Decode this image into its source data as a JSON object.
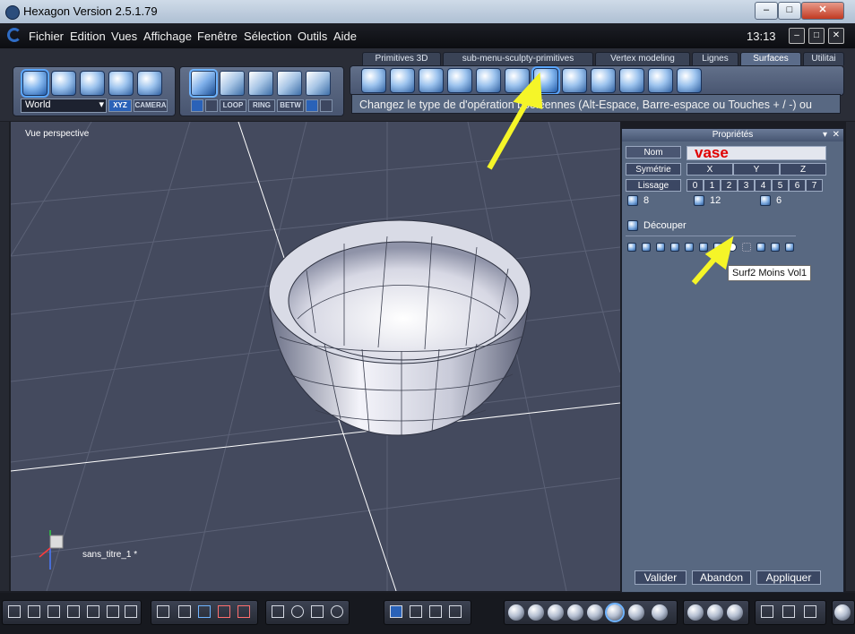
{
  "window": {
    "title": "Hexagon Version 2.5.1.79",
    "controls": [
      "–",
      "□",
      "✕"
    ]
  },
  "menu": {
    "items": [
      "Fichier",
      "Edition",
      "Vues",
      "Affichage",
      "Fenêtre",
      "Sélection",
      "Outils",
      "Aide"
    ],
    "clock": "13:13"
  },
  "toolbar": {
    "coord_select": "World",
    "mode_xyz": "XYZ",
    "mode_camera": "CAMERA",
    "select_modes": [
      "LOOP",
      "RING",
      "BETW"
    ],
    "tabs": [
      {
        "label": "Primitives 3D",
        "active": false
      },
      {
        "label": "sub-menu-sculpty-primitives",
        "active": false
      },
      {
        "label": "Vertex modeling",
        "active": false
      },
      {
        "label": "Lignes",
        "active": false
      },
      {
        "label": "Surfaces",
        "active": true
      },
      {
        "label": "Utilitai",
        "active": false
      }
    ],
    "hint": "Changez le type de d'opération booléennes (Alt-Espace, Barre-espace ou Touches + / -) ou"
  },
  "viewport": {
    "label": "Vue perspective",
    "object_label": "sans_titre_1 *"
  },
  "properties": {
    "title": "Propriétés",
    "name_label": "Nom",
    "name_value": "vase",
    "symmetry_label": "Symétrie",
    "axes": [
      "X",
      "Y",
      "Z"
    ],
    "smoothing_label": "Lissage",
    "smoothing_levels": [
      "0",
      "1",
      "2",
      "3",
      "4",
      "5",
      "6",
      "7"
    ],
    "counts": [
      "8",
      "12",
      "6"
    ],
    "cut_label": "Découper",
    "cut_tooltip": "Surf2 Moins Vol1",
    "buttons": {
      "validate": "Valider",
      "abort": "Abandon",
      "apply": "Appliquer"
    }
  },
  "colors": {
    "accent": "#2f6cc4",
    "highlight_arrow": "#f5f528",
    "name_text": "#e00000"
  }
}
